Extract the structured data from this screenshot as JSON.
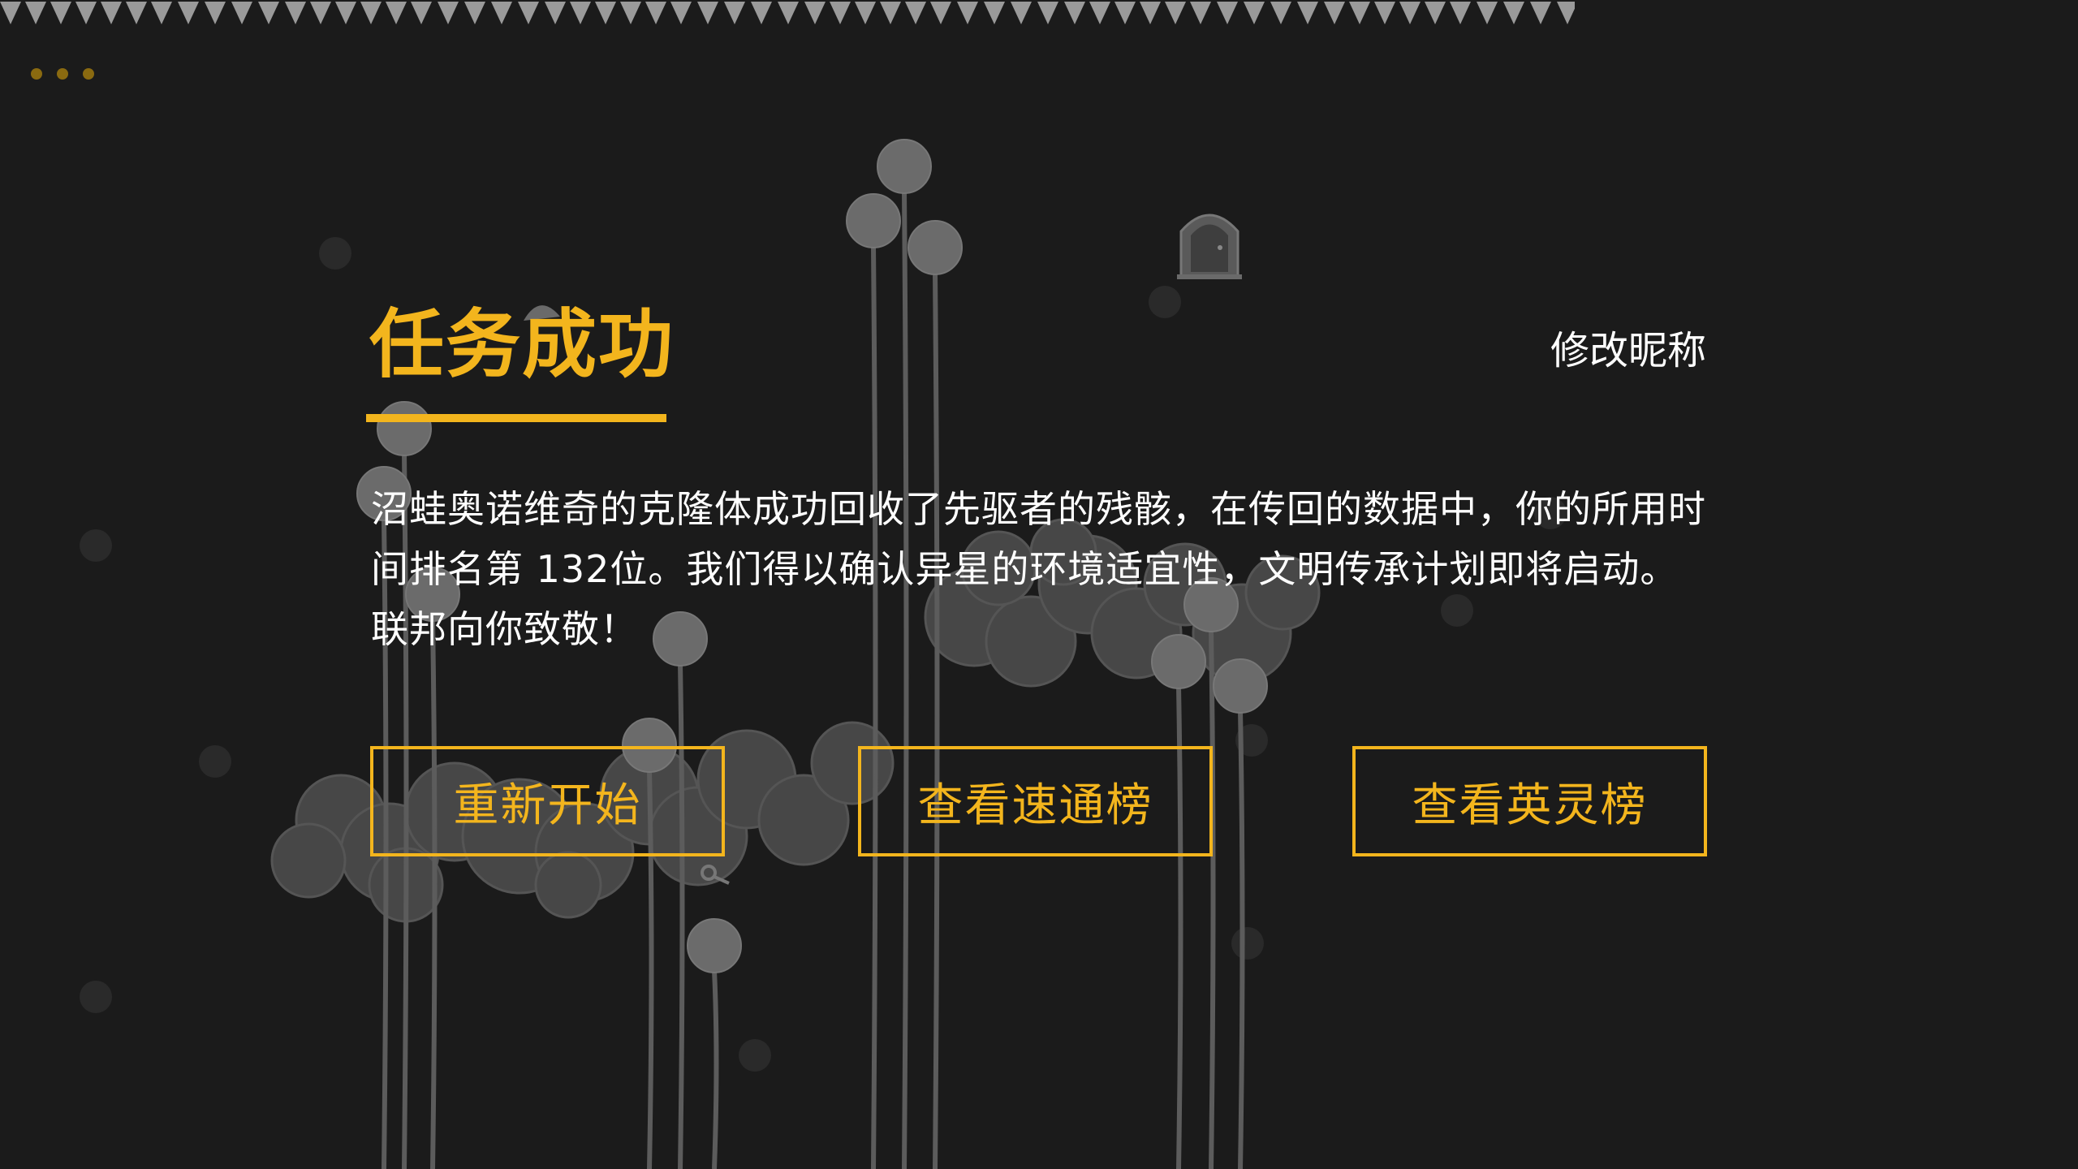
{
  "header": {
    "menu_icon": "more-dots-icon",
    "menu_color": "#8a6a10",
    "border_icon": "spike-row-icon"
  },
  "result": {
    "title": "任务成功",
    "rename_label": "修改昵称",
    "message": "沼蛙奥诺维奇的克隆体成功回收了先驱者的残骸，在传回的数据中，你的所用时间排名第 132位。我们得以确认异星的环境适宜性，文明传承计划即将启动。联邦向你致敬！"
  },
  "buttons": {
    "restart": "重新开始",
    "speed_leaderboard": "查看速通榜",
    "hero_leaderboard": "查看英灵榜"
  },
  "colors": {
    "background": "#1b1b1b",
    "accent": "#f3b51d",
    "text": "#ffffff",
    "scenery": "#5a5a5a"
  }
}
